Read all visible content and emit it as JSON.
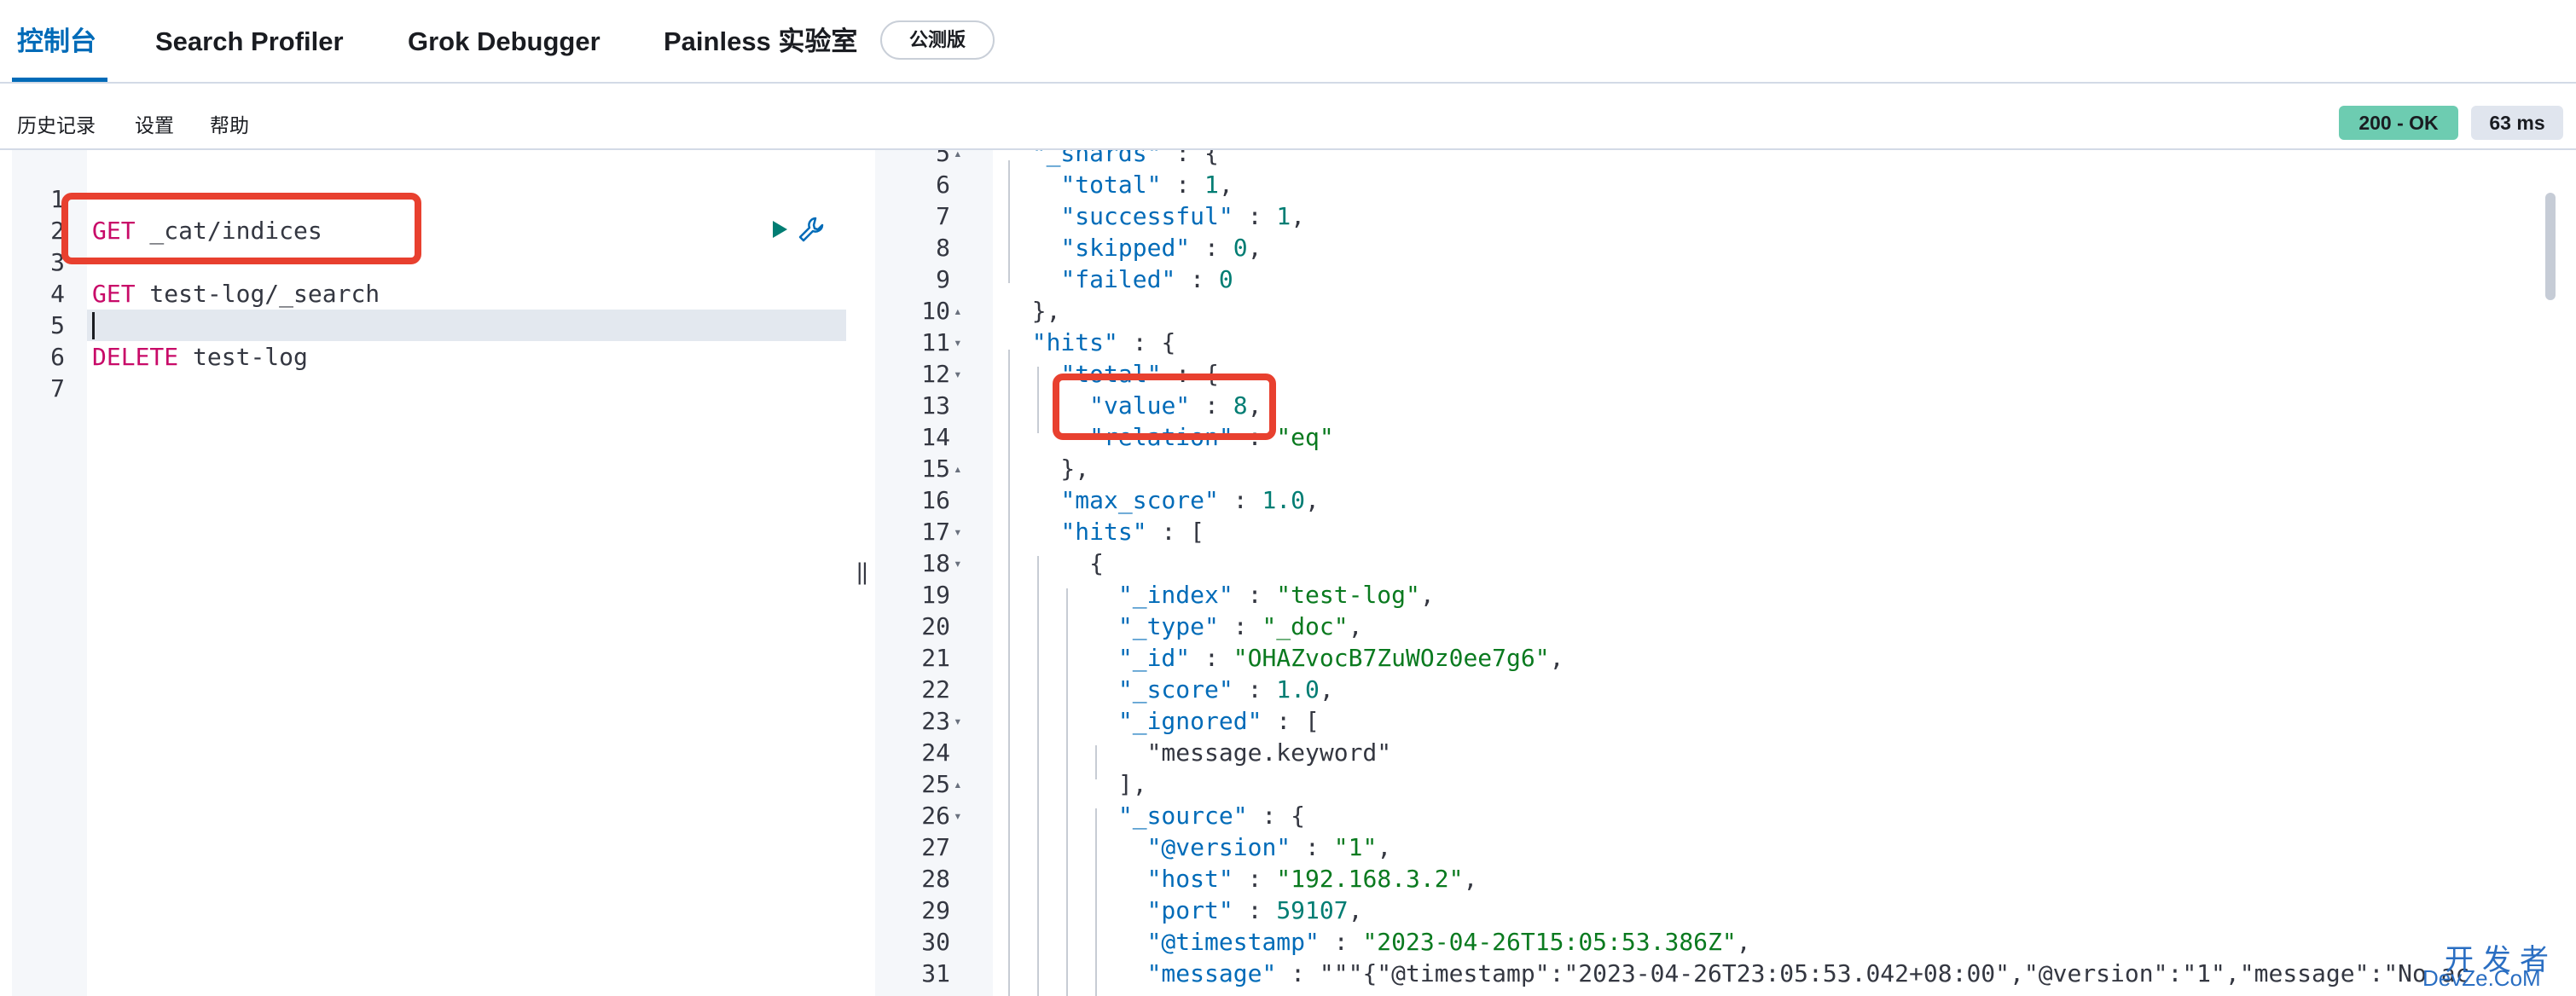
{
  "tabs": [
    {
      "label": "控制台",
      "active": true
    },
    {
      "label": "Search Profiler",
      "active": false
    },
    {
      "label": "Grok Debugger",
      "active": false
    },
    {
      "label": "Painless 实验室",
      "active": false
    }
  ],
  "beta_badge": "公测版",
  "toolbar": {
    "history": "历史记录",
    "settings": "设置",
    "help": "帮助",
    "status": "200 - OK",
    "time": "63 ms"
  },
  "editor": {
    "lines": [
      {
        "n": "1",
        "method": "GET",
        "path": " _cat/indices"
      },
      {
        "n": "2",
        "method": "",
        "path": ""
      },
      {
        "n": "3",
        "method": "GET",
        "path": " test-log/_search"
      },
      {
        "n": "4",
        "method": "",
        "path": ""
      },
      {
        "n": "5",
        "method": "DELETE",
        "path": " test-log"
      },
      {
        "n": "6",
        "method": "",
        "path": ""
      },
      {
        "n": "7",
        "method": "",
        "path": ""
      }
    ]
  },
  "output": {
    "lines": [
      {
        "n": "5",
        "fold": "▴",
        "text": "  \"_shards\" : {"
      },
      {
        "n": "6",
        "fold": "",
        "text": "    \"total\" : 1,"
      },
      {
        "n": "7",
        "fold": "",
        "text": "    \"successful\" : 1,"
      },
      {
        "n": "8",
        "fold": "",
        "text": "    \"skipped\" : 0,"
      },
      {
        "n": "9",
        "fold": "",
        "text": "    \"failed\" : 0"
      },
      {
        "n": "10",
        "fold": "▴",
        "text": "  },"
      },
      {
        "n": "11",
        "fold": "▾",
        "text": "  \"hits\" : {"
      },
      {
        "n": "12",
        "fold": "▾",
        "text": "    \"total\" : {"
      },
      {
        "n": "13",
        "fold": "",
        "text": "      \"value\" : 8,"
      },
      {
        "n": "14",
        "fold": "",
        "text": "      \"relation\" : \"eq\""
      },
      {
        "n": "15",
        "fold": "▴",
        "text": "    },"
      },
      {
        "n": "16",
        "fold": "",
        "text": "    \"max_score\" : 1.0,"
      },
      {
        "n": "17",
        "fold": "▾",
        "text": "    \"hits\" : ["
      },
      {
        "n": "18",
        "fold": "▾",
        "text": "      {"
      },
      {
        "n": "19",
        "fold": "",
        "text": "        \"_index\" : \"test-log\","
      },
      {
        "n": "20",
        "fold": "",
        "text": "        \"_type\" : \"_doc\","
      },
      {
        "n": "21",
        "fold": "",
        "text": "        \"_id\" : \"OHAZvocB7ZuWOz0ee7g6\","
      },
      {
        "n": "22",
        "fold": "",
        "text": "        \"_score\" : 1.0,"
      },
      {
        "n": "23",
        "fold": "▾",
        "text": "        \"_ignored\" : ["
      },
      {
        "n": "24",
        "fold": "",
        "text": "          \"message.keyword\""
      },
      {
        "n": "25",
        "fold": "▴",
        "text": "        ],"
      },
      {
        "n": "26",
        "fold": "▾",
        "text": "        \"_source\" : {"
      },
      {
        "n": "27",
        "fold": "",
        "text": "          \"@version\" : \"1\","
      },
      {
        "n": "28",
        "fold": "",
        "text": "          \"host\" : \"192.168.3.2\","
      },
      {
        "n": "29",
        "fold": "",
        "text": "          \"port\" : 59107,"
      },
      {
        "n": "30",
        "fold": "",
        "text": "          \"@timestamp\" : \"2023-04-26T15:05:53.386Z\","
      },
      {
        "n": "31",
        "fold": "",
        "text": "          \"message\" : \"\"\"{\"@timestamp\":\"2023-04-26T23:05:53.042+08:00\",\"@version\":\"1\",\"message\":\"No ac"
      }
    ]
  },
  "watermark": {
    "main": "开发者",
    "sub": "DevZe.CoM"
  },
  "colors": {
    "accent": "#006bb8",
    "highlight": "#e8402f",
    "ok": "#6dccb1"
  }
}
